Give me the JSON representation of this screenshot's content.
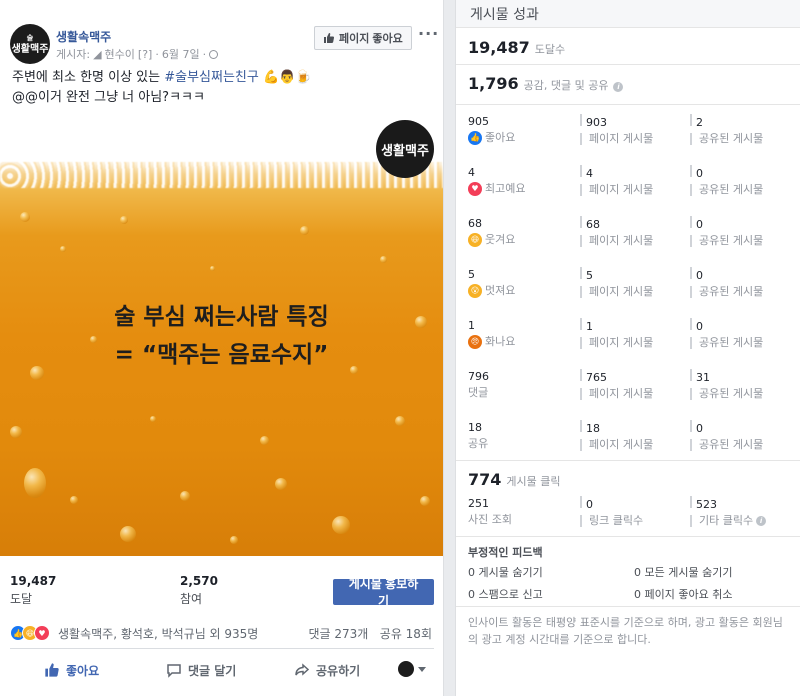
{
  "post": {
    "page_name": "생활속맥주",
    "avatar_text_top": "술",
    "avatar_text": "생활맥주",
    "meta": {
      "author_prefix": "게시자:",
      "author": "현수이",
      "bracket": "[?]",
      "separator": "·",
      "date": "6월 7일",
      "separator2": "·"
    },
    "like_page_label": "페이지 좋아요",
    "more": "···",
    "text_line1_before": "주변에 최소 한명 이상 있는 ",
    "hashtag": "#술부심쩌는친구",
    "text_line1_emoji": "💪👨🍺",
    "text_line2": "@@이거 완전 그냥 너 아님?ㅋㅋㅋ",
    "image": {
      "logo_text": "생활맥주",
      "caption_line1": "술 부심 쩌는사람 특징",
      "caption_line2": "= “맥주는 음료수지”"
    },
    "stats": {
      "reach_value": "19,487",
      "reach_label": "도달",
      "engagement_value": "2,570",
      "engagement_label": "참여",
      "boost_label": "게시물 홍보하기"
    },
    "reactions": {
      "names": "생활속맥주, 황석호, 박석규님 외 935명",
      "comments": "댓글 273개",
      "shares": "공유 18회"
    },
    "actions": {
      "like": "좋아요",
      "comment": "댓글 달기",
      "share": "공유하기"
    },
    "colors": {
      "link": "#365899",
      "boost": "#4267b2"
    }
  },
  "insights": {
    "title": "게시물 성과",
    "reach": {
      "value": "19,487",
      "label": "도달수"
    },
    "engagement": {
      "value": "1,796",
      "label": "공감, 댓글 및 공유"
    },
    "rows": [
      {
        "total": "905",
        "type": "좋아요",
        "icon": "like-icon",
        "on_post": "903",
        "on_post_label": "페이지 게시물",
        "on_shares": "2",
        "on_shares_label": "공유된 게시물"
      },
      {
        "total": "4",
        "type": "최고예요",
        "icon": "love-icon",
        "on_post": "4",
        "on_post_label": "페이지 게시물",
        "on_shares": "0",
        "on_shares_label": "공유된 게시물"
      },
      {
        "total": "68",
        "type": "웃겨요",
        "icon": "haha-icon",
        "on_post": "68",
        "on_post_label": "페이지 게시물",
        "on_shares": "0",
        "on_shares_label": "공유된 게시물"
      },
      {
        "total": "5",
        "type": "멋져요",
        "icon": "wow-icon",
        "on_post": "5",
        "on_post_label": "페이지 게시물",
        "on_shares": "0",
        "on_shares_label": "공유된 게시물"
      },
      {
        "total": "1",
        "type": "화나요",
        "icon": "angry-icon",
        "on_post": "1",
        "on_post_label": "페이지 게시물",
        "on_shares": "0",
        "on_shares_label": "공유된 게시물"
      },
      {
        "total": "796",
        "type": "댓글",
        "icon": "",
        "on_post": "765",
        "on_post_label": "페이지 게시물",
        "on_shares": "31",
        "on_shares_label": "공유된 게시물"
      },
      {
        "total": "18",
        "type": "공유",
        "icon": "",
        "on_post": "18",
        "on_post_label": "페이지 게시물",
        "on_shares": "0",
        "on_shares_label": "공유된 게시물"
      }
    ],
    "clicks": {
      "value": "774",
      "label": "게시물 클릭",
      "photo_value": "251",
      "photo_label": "사진 조회",
      "link_value": "0",
      "link_label": "링크 클릭수",
      "other_value": "523",
      "other_label": "기타 클릭수"
    },
    "negative": {
      "title": "부정적인 피드백",
      "hide_post": "0 게시물 숨기기",
      "hide_all": "0 모든 게시물 숨기기",
      "report_spam": "0 스팸으로 신고",
      "unlike_page": "0 페이지 좋아요 취소"
    },
    "note": "인사이트 활동은 태평양 표준시를 기준으로 하며, 광고 활동은 회원님의 광고 계정 시간대를 기준으로 합니다."
  }
}
